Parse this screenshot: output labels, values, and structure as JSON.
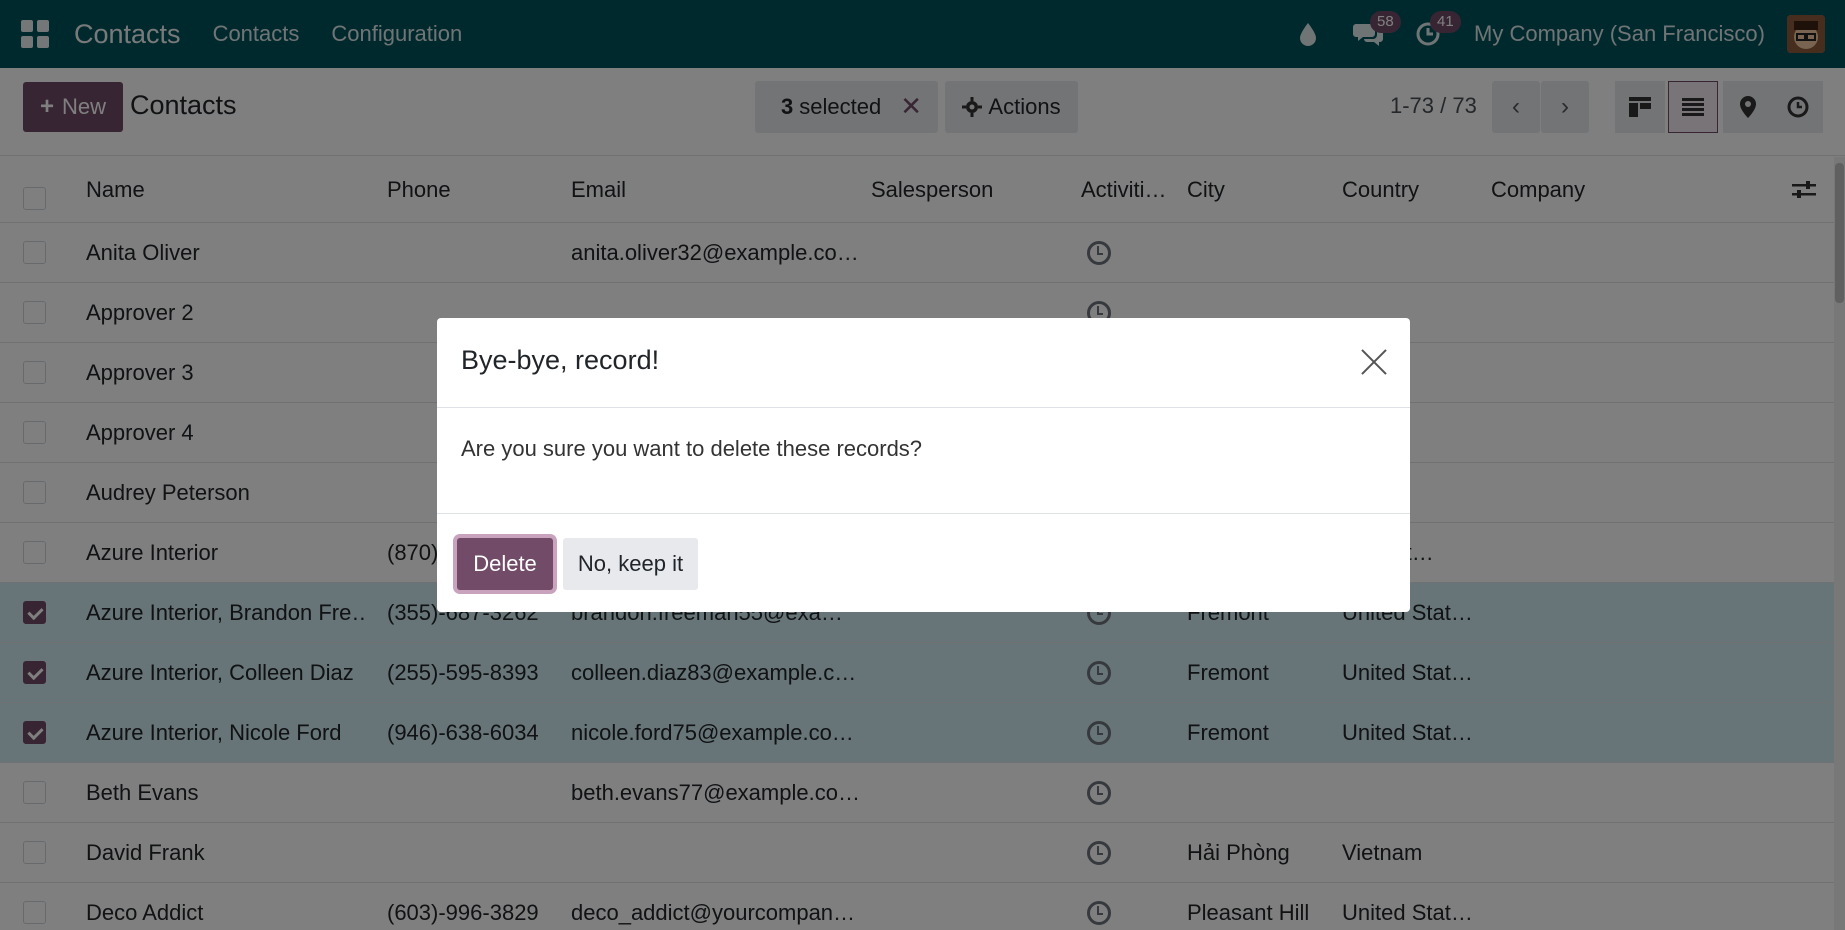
{
  "nav": {
    "app_name": "Contacts",
    "menu": [
      "Contacts",
      "Configuration"
    ],
    "messages_badge": "58",
    "activities_badge": "41",
    "company": "My Company (San Francisco)"
  },
  "control_panel": {
    "new_label": "New",
    "title": "Contacts",
    "selected_count": "3",
    "selected_label": "selected",
    "actions_label": "Actions",
    "pager": "1-73 / 73"
  },
  "table": {
    "columns": [
      "Name",
      "Phone",
      "Email",
      "Salesperson",
      "Activiti…",
      "City",
      "Country",
      "Company"
    ],
    "rows": [
      {
        "name": "Anita Oliver",
        "phone": "",
        "email": "anita.oliver32@example.co…",
        "city": "",
        "country": "",
        "selected": false
      },
      {
        "name": "Approver 2",
        "phone": "",
        "email": "",
        "city": "",
        "country": "",
        "selected": false
      },
      {
        "name": "Approver 3",
        "phone": "",
        "email": "",
        "city": "",
        "country": "",
        "selected": false
      },
      {
        "name": "Approver 4",
        "phone": "",
        "email": "",
        "city": "",
        "country": "",
        "selected": false
      },
      {
        "name": "Audrey Peterson",
        "phone": "",
        "email": "",
        "city": "",
        "country": "",
        "selected": false
      },
      {
        "name": "Azure Interior",
        "phone": "(870)",
        "email": "",
        "city": "",
        "country": "ed Stat…",
        "selected": false
      },
      {
        "name": "Azure Interior, Brandon Fre…",
        "phone": "(355)-687-3262",
        "email": "brandon.freeman55@exa…",
        "city": "Fremont",
        "country": "United Stat…",
        "selected": true
      },
      {
        "name": "Azure Interior, Colleen Diaz",
        "phone": "(255)-595-8393",
        "email": "colleen.diaz83@example.c…",
        "city": "Fremont",
        "country": "United Stat…",
        "selected": true
      },
      {
        "name": "Azure Interior, Nicole Ford",
        "phone": "(946)-638-6034",
        "email": "nicole.ford75@example.co…",
        "city": "Fremont",
        "country": "United Stat…",
        "selected": true
      },
      {
        "name": "Beth Evans",
        "phone": "",
        "email": "beth.evans77@example.co…",
        "city": "",
        "country": "",
        "selected": false
      },
      {
        "name": "David Frank",
        "phone": "",
        "email": "",
        "city": "Hải Phòng",
        "country": "Vietnam",
        "selected": false
      },
      {
        "name": "Deco Addict",
        "phone": "(603)-996-3829",
        "email": "deco_addict@yourcompan…",
        "city": "Pleasant Hill",
        "country": "United Stat…",
        "selected": false
      }
    ]
  },
  "dialog": {
    "title": "Bye-bye, record!",
    "message": "Are you sure you want to delete these records?",
    "confirm_label": "Delete",
    "cancel_label": "No, keep it"
  },
  "colors": {
    "navbar": "#00525c",
    "primary": "#714b67",
    "selected_row": "#cfe9f1"
  }
}
